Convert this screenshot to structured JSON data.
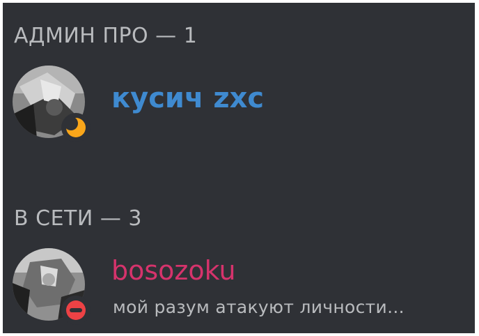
{
  "colors": {
    "background": "#2f3136",
    "header_text": "#b9bbbe",
    "admin_name": "#3f8ad0",
    "member_name": "#d6336c",
    "status_idle": "#faa61a",
    "status_dnd": "#ed4245"
  },
  "groups": [
    {
      "header": "АДМИН ПРО — 1",
      "members": [
        {
          "name": "кусич zxc",
          "status": "idle",
          "status_icon": "moon-icon",
          "activity": ""
        }
      ]
    },
    {
      "header": "В СЕТИ — 3",
      "members": [
        {
          "name": "bosozoku",
          "status": "dnd",
          "status_icon": "do-not-disturb-icon",
          "activity": "мой разум атакуют личности..."
        }
      ]
    }
  ]
}
